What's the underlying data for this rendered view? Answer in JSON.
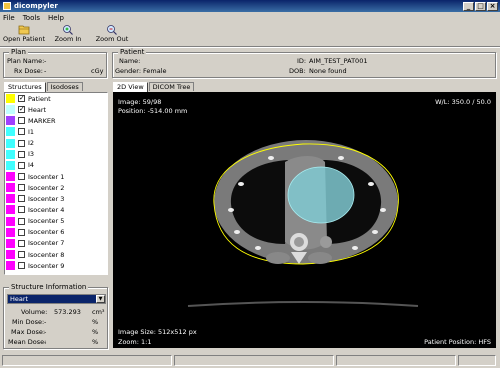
{
  "window": {
    "title": "dicompyler"
  },
  "menu": [
    "File",
    "Tools",
    "Help"
  ],
  "toolbar": {
    "open_patient": "Open Patient",
    "zoom_in": "Zoom In",
    "zoom_out": "Zoom Out"
  },
  "plan": {
    "group_title": "Plan",
    "name_label": "Plan Name:",
    "name_value": "-",
    "rx_label": "Rx Dose:",
    "rx_value": "-",
    "rx_unit": "cGy"
  },
  "patient": {
    "group_title": "Patient",
    "name_label": "Name:",
    "name_value": "",
    "gender_label": "Gender:",
    "gender_value": "Female",
    "id_label": "ID:",
    "id_value": "AIM_TEST_PAT001",
    "dob_label": "DOB:",
    "dob_value": "None found"
  },
  "left_tabs": [
    "Structures",
    "Isodoses"
  ],
  "structures": [
    {
      "label": "Patient",
      "color": "#ffff00",
      "checked": true
    },
    {
      "label": "Heart",
      "color": "#c0ffff",
      "checked": true
    },
    {
      "label": "MARKER",
      "color": "#a040ff",
      "checked": false
    },
    {
      "label": "I1",
      "color": "#40ffff",
      "checked": false
    },
    {
      "label": "I2",
      "color": "#40ffff",
      "checked": false
    },
    {
      "label": "I3",
      "color": "#40ffff",
      "checked": false
    },
    {
      "label": "I4",
      "color": "#40ffff",
      "checked": false
    },
    {
      "label": "Isocenter 1",
      "color": "#ff00ff",
      "checked": false
    },
    {
      "label": "Isocenter 2",
      "color": "#ff00ff",
      "checked": false
    },
    {
      "label": "Isocenter 3",
      "color": "#ff00ff",
      "checked": false
    },
    {
      "label": "Isocenter 4",
      "color": "#ff00ff",
      "checked": false
    },
    {
      "label": "Isocenter 5",
      "color": "#ff00ff",
      "checked": false
    },
    {
      "label": "Isocenter 6",
      "color": "#ff00ff",
      "checked": false
    },
    {
      "label": "Isocenter 7",
      "color": "#ff00ff",
      "checked": false
    },
    {
      "label": "Isocenter 8",
      "color": "#ff00ff",
      "checked": false
    },
    {
      "label": "Isocenter 9",
      "color": "#ff00ff",
      "checked": false
    }
  ],
  "structure_info": {
    "group_title": "Structure Information",
    "selected": "Heart",
    "volume_label": "Volume:",
    "volume_value": "573.293",
    "volume_unit": "cm³",
    "min_label": "Min Dose:",
    "min_value": "-",
    "min_unit": "%",
    "max_label": "Max Dose:",
    "max_value": "-",
    "max_unit": "%",
    "mean_label": "Mean Dose:",
    "mean_value": "-",
    "mean_unit": "%"
  },
  "view_tabs": [
    "2D View",
    "DICOM Tree"
  ],
  "viewer": {
    "image_label": "Image: 59/98",
    "position_label": "Position: -514.00 mm",
    "wl_label": "W/L: 350.0 / 50.0",
    "size_label": "Image Size: 512x512 px",
    "zoom_label": "Zoom: 1:1",
    "patient_position_label": "Patient Position: HFS"
  },
  "colors": {
    "window_bg": "#d4d0c8",
    "titlebar": "#0a246a",
    "heart_contour": "#7fd8e0",
    "patient_contour": "#ffff00"
  }
}
